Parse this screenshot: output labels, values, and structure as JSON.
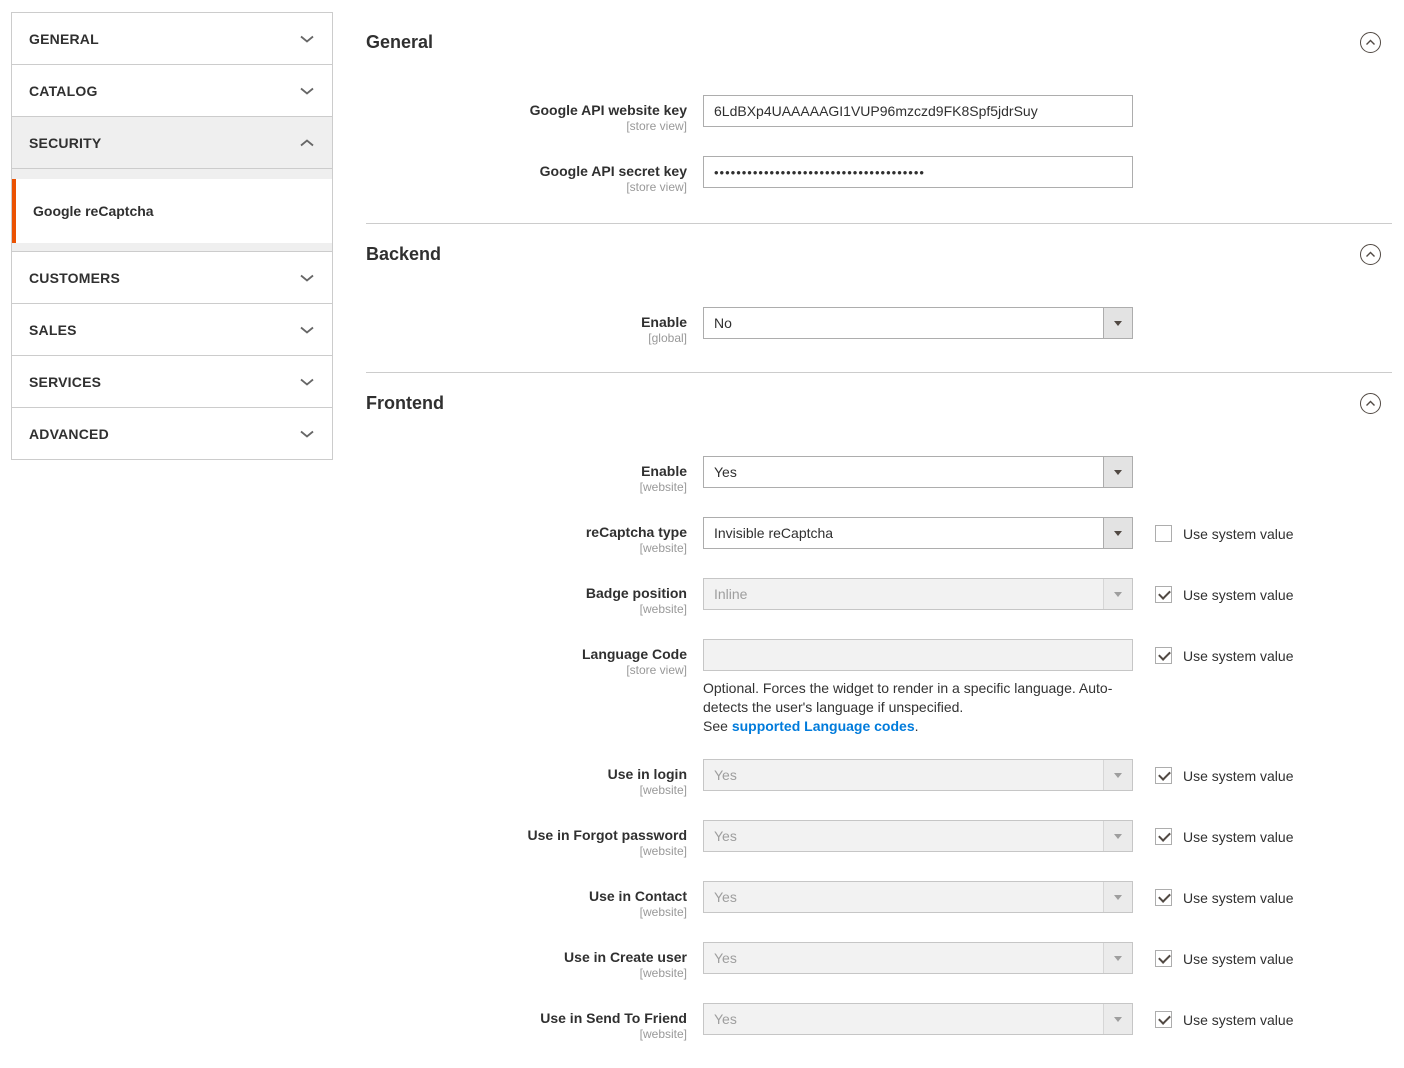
{
  "accent_color": "#eb5202",
  "link_color": "#007bdb",
  "sidebar": {
    "sections": [
      {
        "label": "GENERAL",
        "expanded": false
      },
      {
        "label": "CATALOG",
        "expanded": false
      },
      {
        "label": "SECURITY",
        "expanded": true,
        "items": [
          {
            "label": "Google reCaptcha",
            "active": true
          }
        ]
      },
      {
        "label": "CUSTOMERS",
        "expanded": false
      },
      {
        "label": "SALES",
        "expanded": false
      },
      {
        "label": "SERVICES",
        "expanded": false
      },
      {
        "label": "ADVANCED",
        "expanded": false
      }
    ]
  },
  "sections": {
    "general": {
      "title": "General",
      "fields": [
        {
          "label": "Google API website key",
          "scope": "[store view]",
          "value": "6LdBXp4UAAAAAGI1VUP96mzczd9FK8Spf5jdrSuy",
          "type": "text"
        },
        {
          "label": "Google API secret key",
          "scope": "[store view]",
          "value": "••••••••••••••••••••••••••••••••••••••",
          "type": "password"
        }
      ]
    },
    "backend": {
      "title": "Backend",
      "fields": [
        {
          "label": "Enable",
          "scope": "[global]",
          "value": "No",
          "type": "select",
          "disabled": false
        }
      ]
    },
    "frontend": {
      "title": "Frontend",
      "use_system_label": "Use system value",
      "fields": [
        {
          "label": "Enable",
          "scope": "[website]",
          "value": "Yes",
          "type": "select",
          "disabled": false
        },
        {
          "label": "reCaptcha type",
          "scope": "[website]",
          "value": "Invisible reCaptcha",
          "type": "select",
          "disabled": false,
          "use_system": false
        },
        {
          "label": "Badge position",
          "scope": "[website]",
          "value": "Inline",
          "type": "select",
          "disabled": true,
          "use_system": true
        },
        {
          "label": "Language Code",
          "scope": "[store view]",
          "value": "",
          "type": "text",
          "disabled": true,
          "use_system": true,
          "note": "Optional. Forces the widget to render in a specific language. Auto-detects the user's language if unspecified.",
          "note_prefix": "See ",
          "note_link": "supported Language codes",
          "note_suffix": "."
        },
        {
          "label": "Use in login",
          "scope": "[website]",
          "value": "Yes",
          "type": "select",
          "disabled": true,
          "use_system": true
        },
        {
          "label": "Use in Forgot password",
          "scope": "[website]",
          "value": "Yes",
          "type": "select",
          "disabled": true,
          "use_system": true
        },
        {
          "label": "Use in Contact",
          "scope": "[website]",
          "value": "Yes",
          "type": "select",
          "disabled": true,
          "use_system": true
        },
        {
          "label": "Use in Create user",
          "scope": "[website]",
          "value": "Yes",
          "type": "select",
          "disabled": true,
          "use_system": true
        },
        {
          "label": "Use in Send To Friend",
          "scope": "[website]",
          "value": "Yes",
          "type": "select",
          "disabled": true,
          "use_system": true
        }
      ]
    }
  }
}
